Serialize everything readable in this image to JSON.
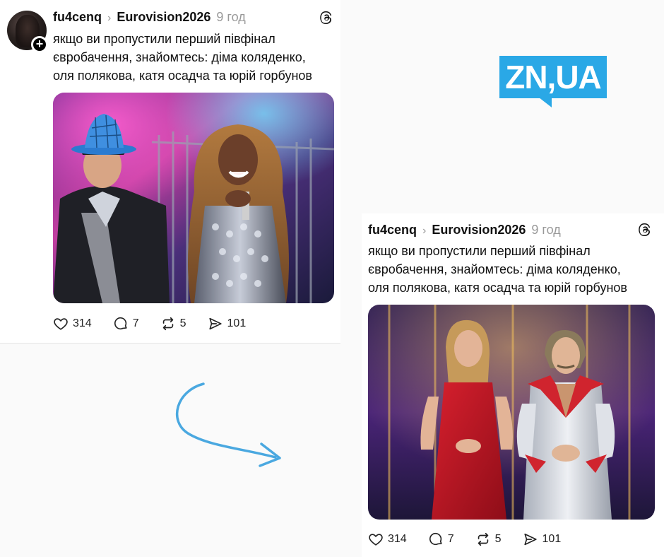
{
  "post_left": {
    "username": "fu4cenq",
    "separator": "›",
    "topic": "Eurovision2026",
    "time": "9 год",
    "text_lines": [
      "якщо ви пропустили перший півфінал",
      "євробачення, знайомтесь: діма коляденко,",
      "оля полякова, катя осадча та юрій горбунов"
    ],
    "stats": {
      "likes": "314",
      "comments": "7",
      "reposts": "5",
      "shares": "101"
    }
  },
  "post_right": {
    "username": "fu4cenq",
    "separator": "›",
    "topic": "Eurovision2026",
    "time": "9 год",
    "text_lines": [
      "якщо ви пропустили перший півфінал",
      "євробачення, знайомтесь: діма коляденко,",
      "оля полякова, катя осадча та юрій горбунов"
    ],
    "stats": {
      "likes": "314",
      "comments": "7",
      "reposts": "5",
      "shares": "101"
    }
  },
  "logo": {
    "text": "ZN,UA"
  },
  "colors": {
    "logo": "#2aa8e6",
    "arrow": "#4aa8e0",
    "muted": "#999999"
  },
  "icons": [
    "plus-icon",
    "threads-icon",
    "heart-icon",
    "comment-icon",
    "repost-icon",
    "share-icon",
    "arrow-icon"
  ]
}
